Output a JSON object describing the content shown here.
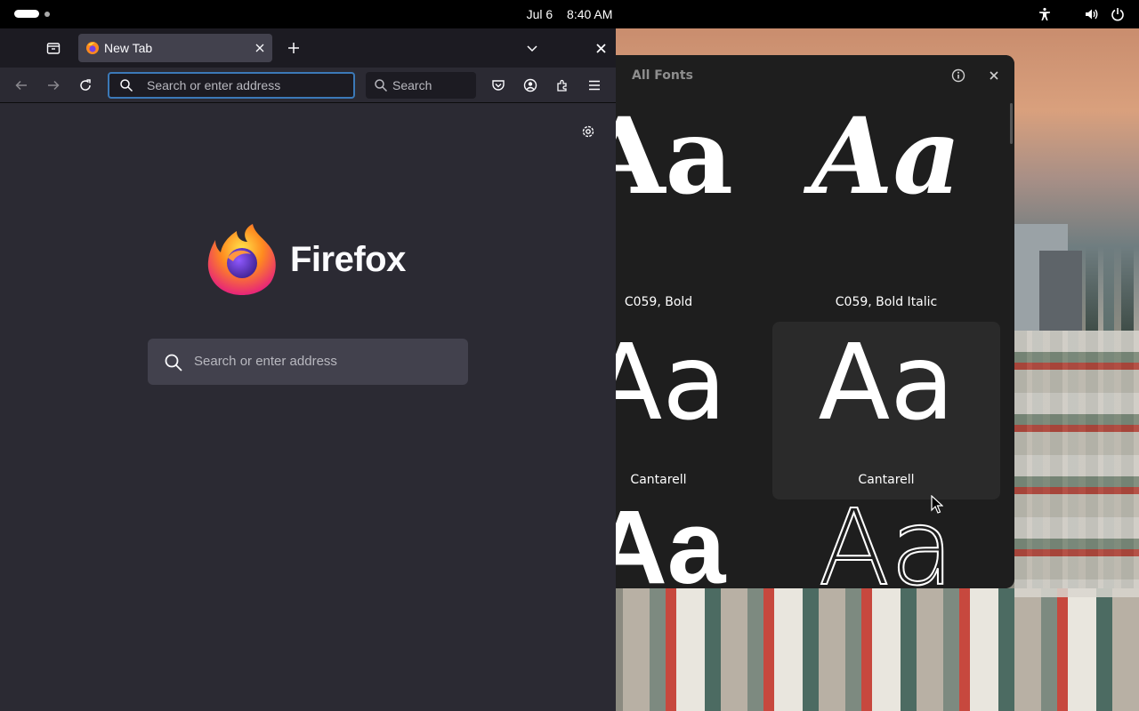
{
  "topbar": {
    "date": "Jul 6",
    "time": "8:40 AM"
  },
  "firefox": {
    "tab": {
      "title": "New Tab"
    },
    "urlbar": {
      "placeholder": "Search or enter address"
    },
    "searchbar": {
      "placeholder": "Search"
    },
    "content": {
      "brand": "Firefox",
      "search_placeholder": "Search or enter address"
    }
  },
  "fonts_app": {
    "title": "All Fonts",
    "fonts": [
      {
        "sample": "Aa",
        "label": "C059, Bold"
      },
      {
        "sample": "Aa",
        "label": "C059, Bold Italic"
      },
      {
        "sample": "Aa",
        "label": "Cantarell"
      },
      {
        "sample": "Aa",
        "label": "Cantarell"
      },
      {
        "sample": "Aa",
        "label": ""
      },
      {
        "sample": "Aa",
        "label": ""
      }
    ]
  },
  "colors": {
    "firefox_bg": "#2b2a33",
    "firefox_tabbar": "#1c1b22",
    "fonts_bg": "#1e1e1e",
    "accent_focus": "#3b79b8"
  }
}
